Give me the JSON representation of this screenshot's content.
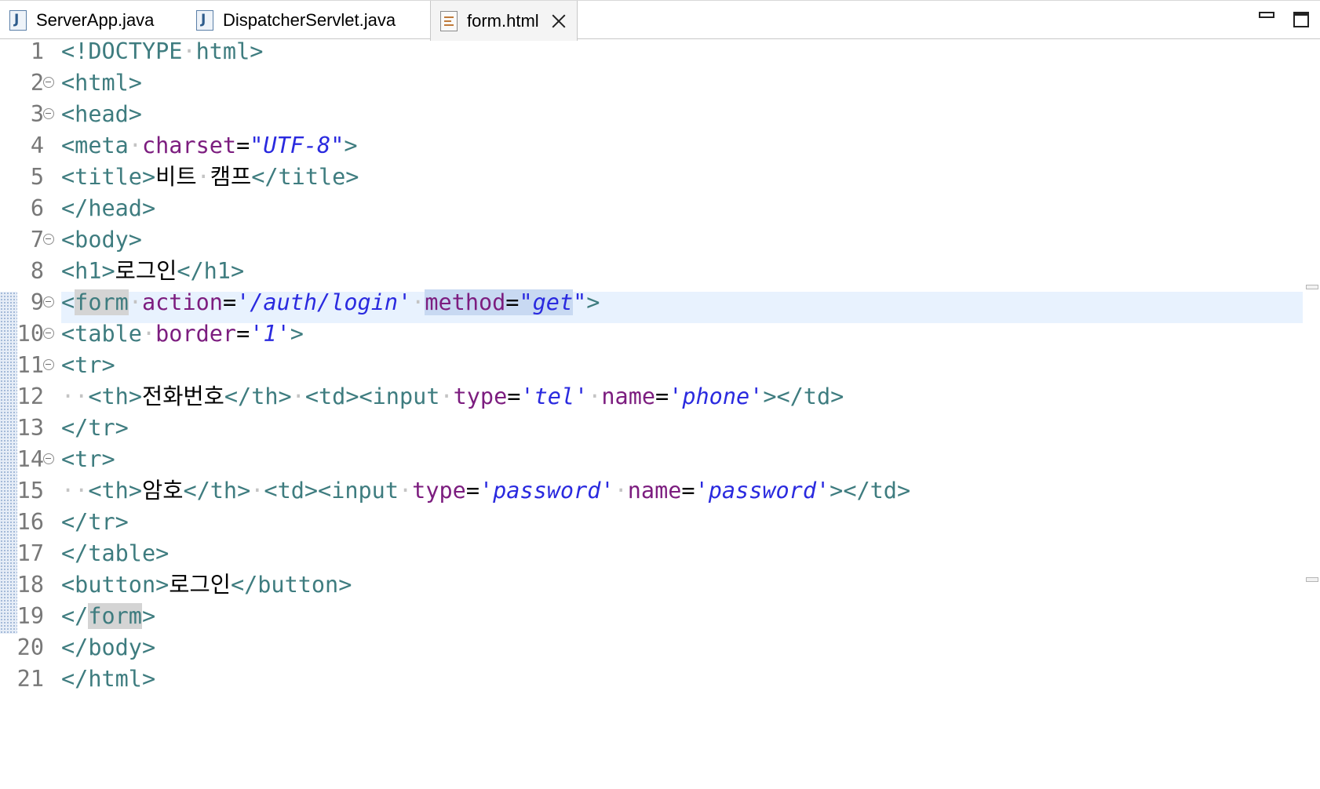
{
  "tabs": [
    {
      "label": "ServerApp.java",
      "icon": "java-file-icon",
      "active": false
    },
    {
      "label": "DispatcherServlet.java",
      "icon": "java-file-icon",
      "active": false
    },
    {
      "label": "form.html",
      "icon": "html-file-icon",
      "active": true
    }
  ],
  "window_controls": {
    "minimize": "minimize-icon",
    "maximize": "maximize-icon"
  },
  "editor": {
    "current_line": 9,
    "lines": [
      {
        "n": "1",
        "fold": false
      },
      {
        "n": "2",
        "fold": true
      },
      {
        "n": "3",
        "fold": true
      },
      {
        "n": "4",
        "fold": false
      },
      {
        "n": "5",
        "fold": false
      },
      {
        "n": "6",
        "fold": false
      },
      {
        "n": "7",
        "fold": true
      },
      {
        "n": "8",
        "fold": false
      },
      {
        "n": "9",
        "fold": true
      },
      {
        "n": "10",
        "fold": true
      },
      {
        "n": "11",
        "fold": true
      },
      {
        "n": "12",
        "fold": false
      },
      {
        "n": "13",
        "fold": false
      },
      {
        "n": "14",
        "fold": true
      },
      {
        "n": "15",
        "fold": false
      },
      {
        "n": "16",
        "fold": false
      },
      {
        "n": "17",
        "fold": false
      },
      {
        "n": "18",
        "fold": false
      },
      {
        "n": "19",
        "fold": false
      },
      {
        "n": "20",
        "fold": false
      },
      {
        "n": "21",
        "fold": false
      }
    ],
    "tokens": {
      "doctype_open": "<!DOCTYPE",
      "doctype_html": "html>",
      "html_open": "<html>",
      "head_open": "<head>",
      "meta_open": "<meta",
      "charset_attr": "charset",
      "eq": "=",
      "charset_val": "\"UTF-8\"",
      "meta_close": ">",
      "title_open": "<title>",
      "title_text_1": "비트",
      "title_text_2": "캠프",
      "title_close": "</title>",
      "head_close": "</head>",
      "body_open": "<body>",
      "h1_open": "<h1>",
      "h1_text": "로그인",
      "h1_close": "</h1>",
      "lt": "<",
      "form_name": "form",
      "action_attr": "action",
      "action_val": "'/auth/login'",
      "method_attr": "method",
      "method_val_a": "\"get",
      "method_val_b": "\"",
      "gt": ">",
      "table_open": "<table",
      "border_attr": "border",
      "border_val": "'1'",
      "tr_open": "<tr>",
      "th_open": "<th>",
      "th_text_phone": "전화번호",
      "th_close": "</th>",
      "td_open": "<td>",
      "input_open": "<input",
      "type_attr": "type",
      "type_tel": "'tel'",
      "name_attr": "name",
      "name_phone": "'phone'",
      "input_end_td_close": "></td>",
      "tr_close": "</tr>",
      "th_text_pw": "암호",
      "type_password": "'password'",
      "name_password": "'password'",
      "table_close": "</table>",
      "button_open": "<button>",
      "button_text": "로그인",
      "button_close": "</button>",
      "end_lt_slash": "</",
      "body_close": "</body>",
      "html_close": "</html>",
      "ws_dot": "·"
    }
  },
  "colors": {
    "tag": "#3e7c7f",
    "attribute": "#7c1d7f",
    "string": "#2a2adf",
    "current_line": "#e8f2fe",
    "matching_bracket": "#d4d4d4"
  }
}
